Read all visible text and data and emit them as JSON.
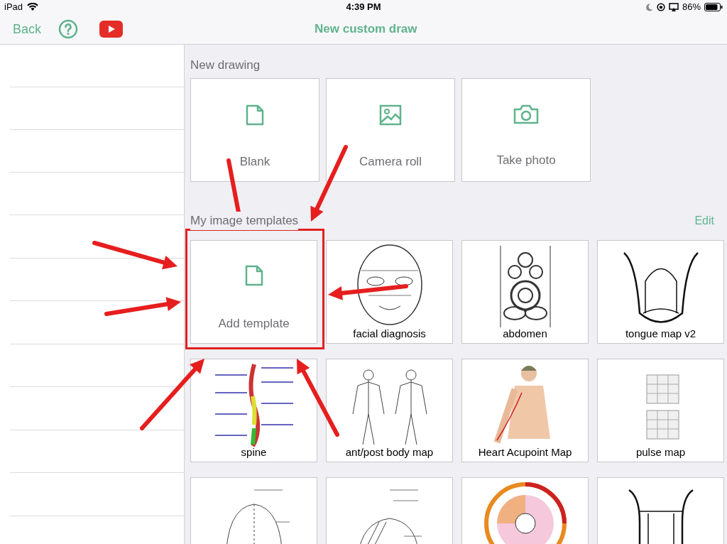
{
  "status_bar": {
    "carrier": "iPad",
    "time": "4:39 PM",
    "battery": "86%"
  },
  "nav": {
    "back": "Back",
    "title": "New custom draw"
  },
  "new_drawing": {
    "heading": "New drawing",
    "options": [
      {
        "kind": "blank",
        "label": "Blank"
      },
      {
        "kind": "camera_roll",
        "label": "Camera roll"
      },
      {
        "kind": "take_photo",
        "label": "Take photo"
      }
    ]
  },
  "templates": {
    "heading": "My image templates",
    "edit": "Edit",
    "items": [
      {
        "kind": "add",
        "label": "Add template"
      },
      {
        "kind": "image",
        "label": "facial diagnosis"
      },
      {
        "kind": "image",
        "label": "abdomen"
      },
      {
        "kind": "image",
        "label": "tongue map v2"
      },
      {
        "kind": "image",
        "label": "spine"
      },
      {
        "kind": "image",
        "label": "ant/post body map"
      },
      {
        "kind": "image",
        "label": "Heart Acupoint Map"
      },
      {
        "kind": "image",
        "label": "pulse map"
      },
      {
        "kind": "image"
      },
      {
        "kind": "image"
      },
      {
        "kind": "image"
      },
      {
        "kind": "image"
      }
    ]
  }
}
